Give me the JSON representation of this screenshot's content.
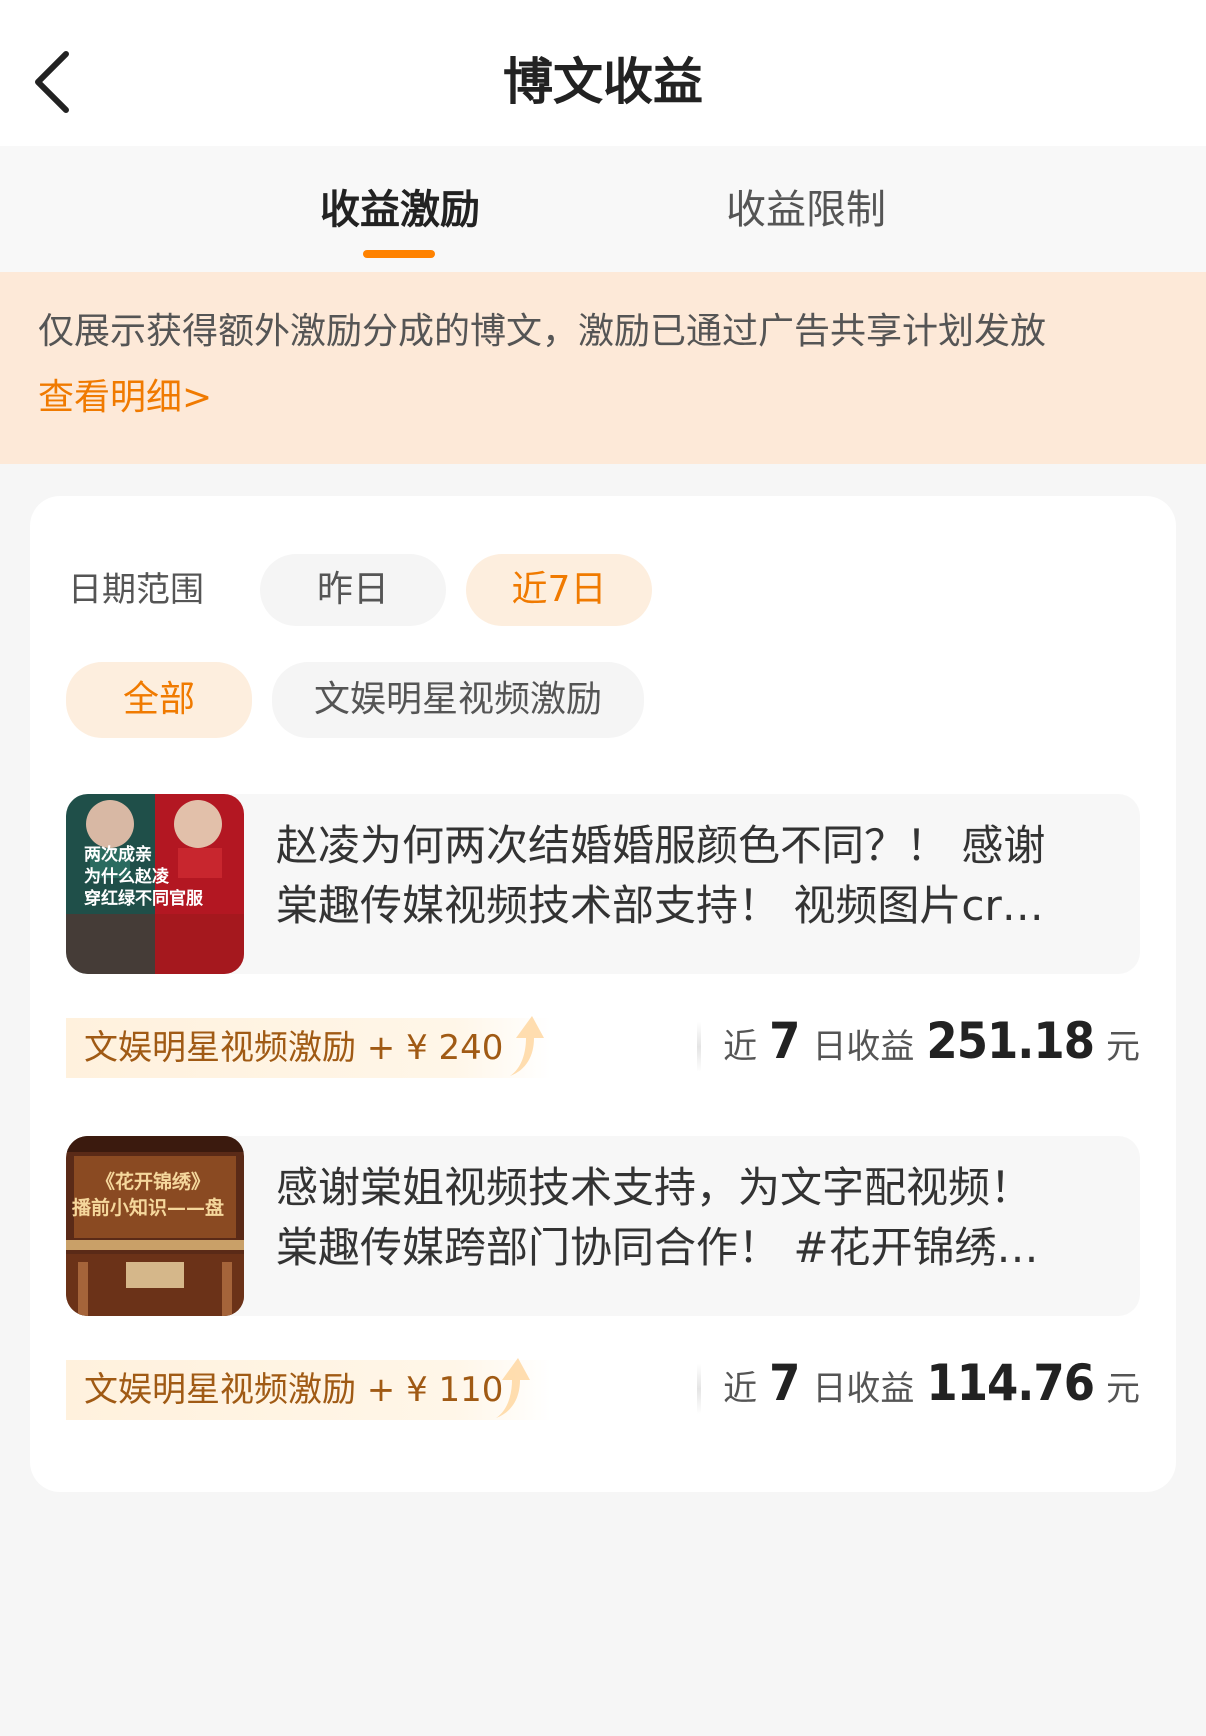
{
  "header": {
    "title": "博文收益"
  },
  "tabs": [
    {
      "label": "收益激励",
      "active": true
    },
    {
      "label": "收益限制",
      "active": false
    }
  ],
  "notice": {
    "text": "仅展示获得额外激励分成的博文，激励已通过广告共享计划发放",
    "link_label": "查看明细>"
  },
  "filters": {
    "date_label": "日期范围",
    "date_options": [
      {
        "label": "昨日",
        "active": false
      },
      {
        "label": "近7日",
        "active": true
      }
    ],
    "type_options": [
      {
        "label": "全部",
        "active": true
      },
      {
        "label": "文娱明星视频激励",
        "active": false
      }
    ]
  },
  "posts": [
    {
      "line1": "赵凌为何两次结婚婚服颜色不同？！ 感谢",
      "line2": "棠趣传媒视频技术部支持！ 视频图片cr…",
      "thumb_text": [
        "两次成亲",
        "为什么赵凌",
        "穿红绿不同官服"
      ],
      "badge": "文娱明星视频激励 + ¥ 240",
      "earn_pre": "近",
      "earn_days": "7",
      "earn_mid": "日收益",
      "earn_amount": "251.18",
      "earn_unit": "元"
    },
    {
      "line1": "感谢棠姐视频技术支持，为文字配视频！",
      "line2": "棠趣传媒跨部门协同合作！ #花开锦绣…",
      "thumb_text": [
        "《花开锦绣》",
        "播前小知识——盘"
      ],
      "badge": "文娱明星视频激励 + ¥ 110",
      "earn_pre": "近",
      "earn_days": "7",
      "earn_mid": "日收益",
      "earn_amount": "114.76",
      "earn_unit": "元"
    }
  ],
  "colors": {
    "accent": "#ff8200",
    "link": "#f07a00",
    "notice_bg": "#fde9d8"
  },
  "icons": {
    "back": "chevron-left-icon",
    "badge_arrow": "up-arrow-icon"
  }
}
